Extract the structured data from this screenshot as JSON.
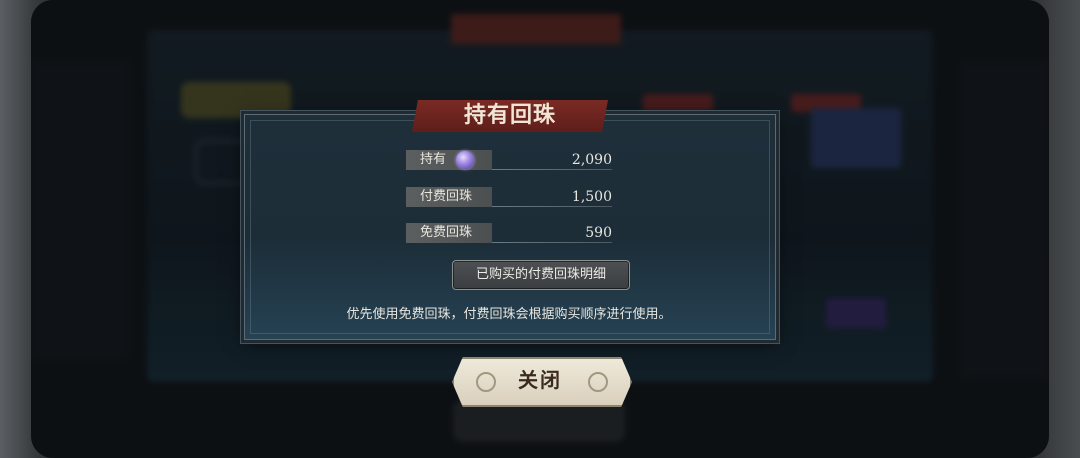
{
  "dialog": {
    "title": "持有回珠",
    "rows": [
      {
        "label": "持有",
        "value": "2,090",
        "icon": "gem-icon"
      },
      {
        "label": "付费回珠",
        "value": "1,500"
      },
      {
        "label": "免费回珠",
        "value": "590"
      }
    ],
    "detail_button": "已购买的付费回珠明细",
    "note": "优先使用免费回珠，付费回珠会根据购买顺序进行使用。",
    "close_button": "关闭"
  },
  "colors": {
    "title_banner": "#6e2520",
    "panel": "#1f2f3a",
    "close_button": "#e6dfcd"
  }
}
